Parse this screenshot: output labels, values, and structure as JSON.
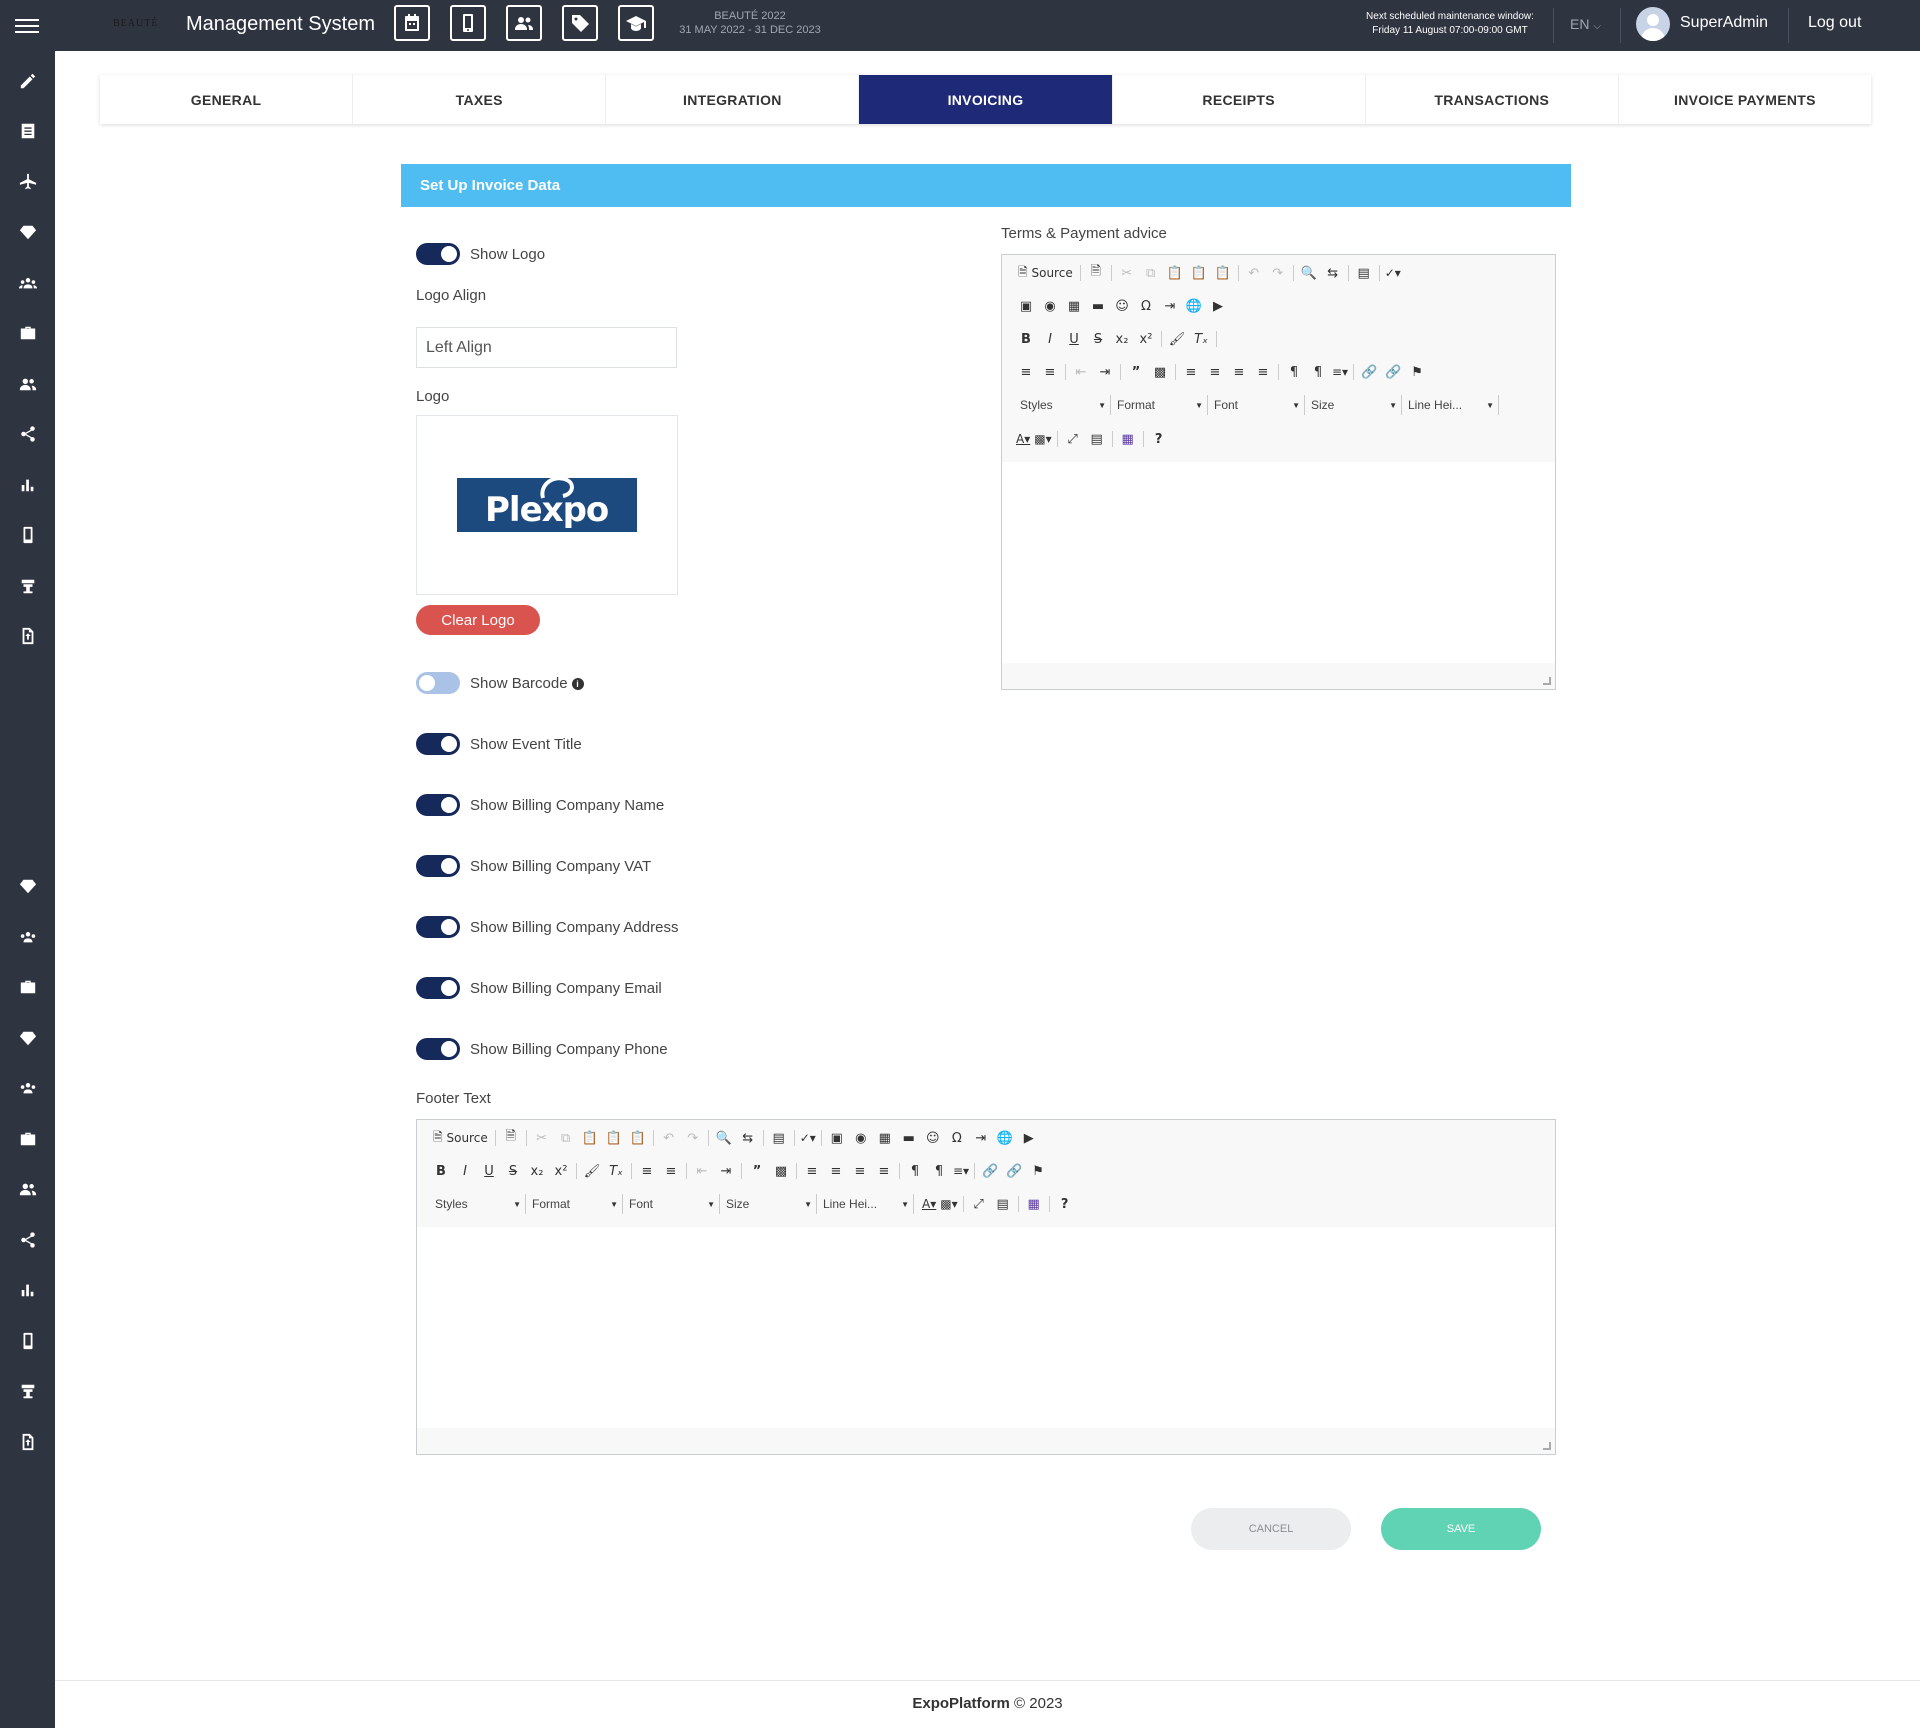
{
  "header": {
    "brand_logo_text": "BEAUTÉ",
    "app_title": "Management System",
    "event_name": "BEAUTÉ 2022",
    "event_dates": "31 MAY 2022 - 31 DEC 2023",
    "maintenance_title": "Next scheduled maintenance window:",
    "maintenance_time": "Friday 11 August 07:00-09:00 GMT",
    "language": "EN",
    "user_name": "SuperAdmin",
    "logout_label": "Log out",
    "icons": [
      "calendar-icon",
      "mobile-icon",
      "users-icon",
      "tag-icon",
      "graduation-cap-icon"
    ]
  },
  "sidebar": {
    "icons": [
      "pencil-icon",
      "list-icon",
      "plane-icon",
      "diamond-icon",
      "group-icon",
      "briefcase-icon",
      "users-icon",
      "share-icon",
      "bar-chart-icon",
      "mobile-icon",
      "stand-icon",
      "file-upload-icon",
      "diamond-icon",
      "group-icon",
      "briefcase-icon",
      "diamond-icon",
      "group-icon",
      "briefcase-icon",
      "users-icon",
      "share-icon",
      "bar-chart-icon",
      "mobile-icon",
      "stand-icon",
      "file-upload-icon"
    ]
  },
  "tabs": [
    {
      "label": "GENERAL",
      "active": false
    },
    {
      "label": "TAXES",
      "active": false
    },
    {
      "label": "INTEGRATION",
      "active": false
    },
    {
      "label": "INVOICING",
      "active": true
    },
    {
      "label": "RECEIPTS",
      "active": false
    },
    {
      "label": "TRANSACTIONS",
      "active": false
    },
    {
      "label": "INVOICE PAYMENTS",
      "active": false
    }
  ],
  "section": {
    "title": "Set Up Invoice Data"
  },
  "form": {
    "show_logo": {
      "label": "Show Logo",
      "on": true
    },
    "logo_align": {
      "label": "Logo Align",
      "value": "Left Align"
    },
    "logo": {
      "label": "Logo",
      "image_text": "Plexpo",
      "clear_label": "Clear Logo"
    },
    "toggles": [
      {
        "label": "Show Barcode",
        "on": false,
        "info": true
      },
      {
        "label": "Show Event Title",
        "on": true
      },
      {
        "label": "Show Billing Company Name",
        "on": true
      },
      {
        "label": "Show Billing Company VAT",
        "on": true
      },
      {
        "label": "Show Billing Company Address",
        "on": true
      },
      {
        "label": "Show Billing Company Email",
        "on": true
      },
      {
        "label": "Show Billing Company Phone",
        "on": true
      }
    ],
    "terms_label": "Terms & Payment advice",
    "footer_label": "Footer Text",
    "editor": {
      "source_label": "Source",
      "combos": [
        "Styles",
        "Format",
        "Font",
        "Size",
        "Line Hei..."
      ]
    }
  },
  "actions": {
    "cancel_label": "CANCEL",
    "save_label": "SAVE"
  },
  "footer": {
    "brand": "ExpoPlatform",
    "copyright": "© 2023"
  },
  "colors": {
    "topbar": "#2f3441",
    "active_tab": "#1e2a78",
    "section_bar": "#4fbdf2",
    "toggle_on": "#15295a",
    "toggle_off": "#a9c2e6",
    "clear_logo": "#d9534f",
    "save": "#5fd3b3"
  }
}
